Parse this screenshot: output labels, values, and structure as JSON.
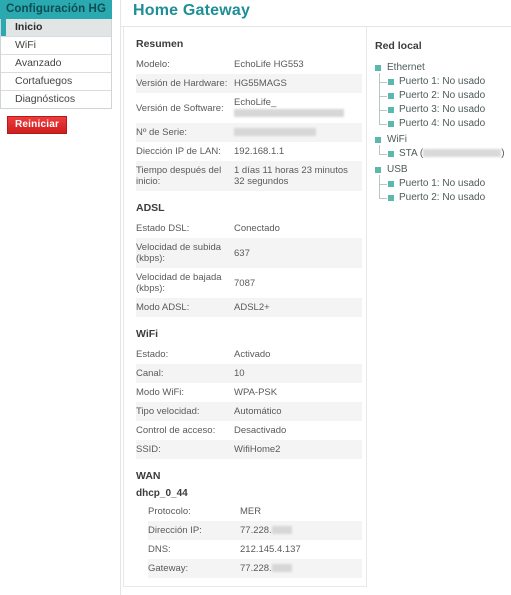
{
  "sidebar": {
    "title": "Configuración HG",
    "items": [
      {
        "label": "Inicio",
        "active": true
      },
      {
        "label": "WiFi",
        "active": false
      },
      {
        "label": "Avanzado",
        "active": false
      },
      {
        "label": "Cortafuegos",
        "active": false
      },
      {
        "label": "Diagnósticos",
        "active": false
      }
    ],
    "reset_button": "Reiniciar"
  },
  "header": {
    "title": "Home Gateway",
    "accent_color": "#1e8f96",
    "sidebar_header_color": "#2aa9b0",
    "reset_button_color": "#e02b2b"
  },
  "sections": {
    "resumen": {
      "title": "Resumen",
      "rows": [
        {
          "key": "Modelo:",
          "value": "EchoLife  HG553",
          "redacted": false
        },
        {
          "key": "Versión de Hardware:",
          "value": "HG55MAGS",
          "redacted": false
        },
        {
          "key": "Versión de Software:",
          "value": "EchoLife_",
          "redacted": true,
          "redact_width": 110
        },
        {
          "key": "Nº de Serie:",
          "value": "",
          "redacted": true,
          "redact_width": 82
        },
        {
          "key": "Diección IP de LAN:",
          "value": "192.168.1.1",
          "redacted": false
        },
        {
          "key": "Tiempo después del inicio:",
          "value": "1 días 11 horas 23 minutos 32 segundos",
          "redacted": false
        }
      ]
    },
    "adsl": {
      "title": "ADSL",
      "rows": [
        {
          "key": "Estado DSL:",
          "value": "Conectado"
        },
        {
          "key": "Velocidad de subida (kbps):",
          "value": "637"
        },
        {
          "key": "Velocidad de bajada (kbps):",
          "value": "7087"
        },
        {
          "key": "Modo ADSL:",
          "value": "ADSL2+"
        }
      ]
    },
    "wifi": {
      "title": "WiFi",
      "rows": [
        {
          "key": "Estado:",
          "value": "Activado"
        },
        {
          "key": "Canal:",
          "value": "10"
        },
        {
          "key": "Modo WiFi:",
          "value": "WPA-PSK"
        },
        {
          "key": "Tipo velocidad:",
          "value": "Automático"
        },
        {
          "key": "Control de acceso:",
          "value": "Desactivado"
        },
        {
          "key": "SSID:",
          "value": "WifiHome2"
        }
      ]
    },
    "wan": {
      "title": "WAN",
      "connection_name": "dhcp_0_44",
      "rows": [
        {
          "key": "Protocolo:",
          "value": "MER",
          "redacted": false
        },
        {
          "key": "Dirección IP:",
          "value": "77.228.",
          "redacted": true,
          "redact_width": 20
        },
        {
          "key": "DNS:",
          "value": "212.145.4.137",
          "redacted": false
        },
        {
          "key": "Gateway:",
          "value": "77.228.",
          "redacted": true,
          "redact_width": 20
        }
      ]
    }
  },
  "red_local": {
    "title": "Red local",
    "bullet_color": "#5cb8ac",
    "groups": [
      {
        "name": "Ethernet",
        "children": [
          "Puerto 1: No usado",
          "Puerto 2: No usado",
          "Puerto 3: No usado",
          "Puerto 4: No usado"
        ]
      },
      {
        "name": "WiFi",
        "children": [
          "STA ("
        ],
        "sta_redacted": true,
        "sta_suffix": ")"
      },
      {
        "name": "USB",
        "children": [
          "Puerto 1: No usado",
          "Puerto 2: No usado"
        ]
      }
    ]
  }
}
